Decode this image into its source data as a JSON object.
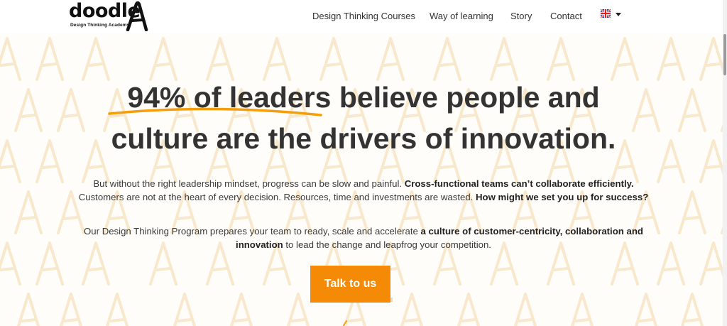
{
  "header": {
    "logo_text": "doodle",
    "logo_letter": "A",
    "logo_tagline": "Design Thinking Academy",
    "nav": [
      {
        "label": "Design Thinking Courses"
      },
      {
        "label": "Way of learning"
      },
      {
        "label": "Story"
      },
      {
        "label": "Contact"
      }
    ],
    "language_flag": "uk-flag-icon"
  },
  "hero": {
    "headline_highlight": "94% of leaders",
    "headline_rest1": " believe people and",
    "headline_line2": "culture are the drivers of innovation.",
    "para1_a": "But without the right leadership mindset, progress can be slow and painful. ",
    "para1_b": "Cross-functional teams can’t collaborate efficiently.",
    "para1_c": " Customers are not at the heart of every decision. Resources, time and investments are wasted. ",
    "para1_d": "How might we set you up for success?",
    "para2_a": "Our Design Thinking Program prepares your team to ready, scale and accelerate ",
    "para2_b": "a culture of customer-centricity, collaboration and innovation",
    "para2_c": " to lead the change and leapfrog your competition.",
    "cta_label": "Talk to us"
  },
  "colors": {
    "accent": "#f58a07",
    "text": "#333333",
    "pattern": "#f7e6c8"
  }
}
